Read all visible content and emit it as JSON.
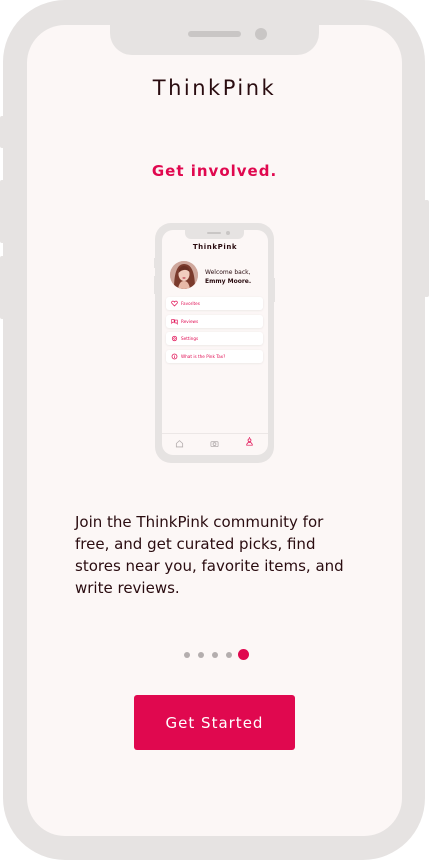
{
  "app": {
    "brand": "ThinkPink",
    "headline": "Get involved.",
    "description": "Join the ThinkPink community for free, and get curated picks, find stores near you, favorite items, and write reviews.",
    "cta_label": "Get Started"
  },
  "preview": {
    "brand": "ThinkPink",
    "welcome_line": "Welcome back,",
    "user_name": "Emmy Moore.",
    "menu": [
      {
        "label": "Favorites",
        "icon": "heart-icon"
      },
      {
        "label": "Reviews",
        "icon": "reviews-icon"
      },
      {
        "label": "Settings",
        "icon": "gear-icon"
      },
      {
        "label": "What is the Pink Tax?",
        "icon": "info-icon"
      }
    ],
    "bottom_nav": [
      "home-icon",
      "camera-icon",
      "profile-icon"
    ]
  },
  "pagination": {
    "total": 5,
    "active": 5
  },
  "colors": {
    "accent": "#e0084f",
    "text": "#2a0c10",
    "background": "#fcf7f6",
    "frame": "#e6e3e2"
  }
}
